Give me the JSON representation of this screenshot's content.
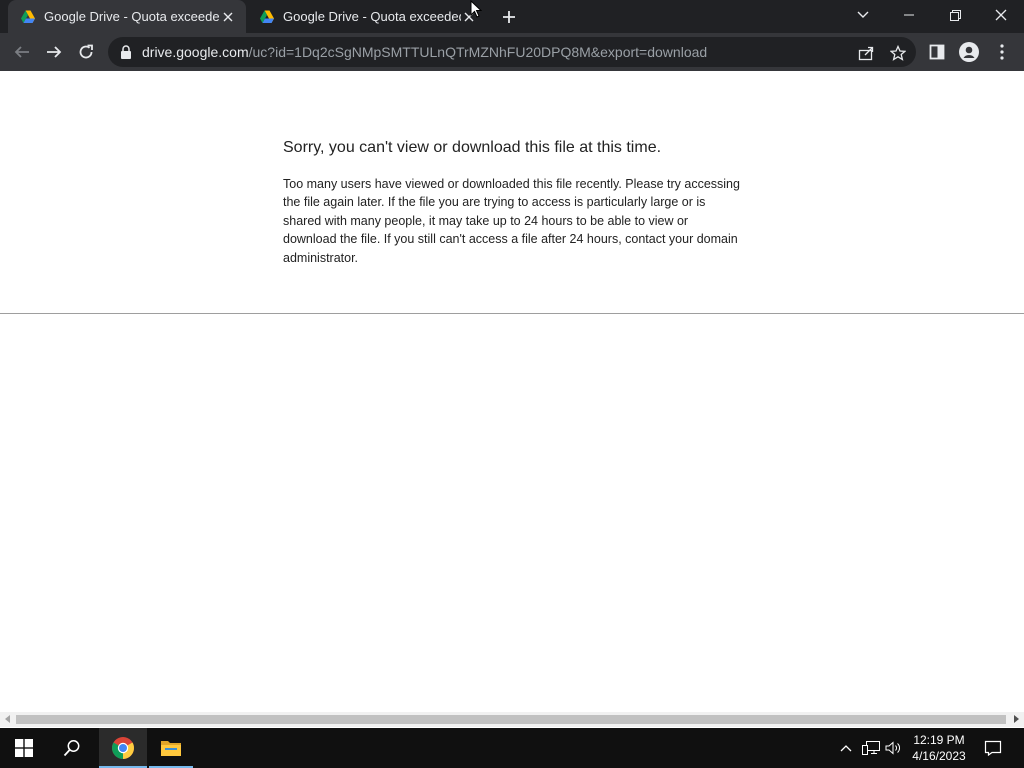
{
  "browser": {
    "tabs": [
      {
        "title": "Google Drive - Quota exceeded",
        "active": true
      },
      {
        "title": "Google Drive - Quota exceeded",
        "active": false
      }
    ],
    "address": {
      "host": "drive.google.com",
      "path": "/uc?id=1Dq2cSgNMpSMTTULnQTrMZNhFU20DPQ8M&export=download"
    }
  },
  "page": {
    "heading": "Sorry, you can't view or download this file at this time.",
    "body": "Too many users have viewed or downloaded this file recently. Please try accessing the file again later. If the file you are trying to access is particularly large or is shared with many people, it may take up to 24 hours to be able to view or download the file. If you still can't access a file after 24 hours, contact your domain administrator."
  },
  "taskbar": {
    "time": "12:19 PM",
    "date": "4/16/2023"
  },
  "colors": {
    "tabstrip": "#202124",
    "toolbar": "#35363a",
    "taskbar": "#101010"
  }
}
